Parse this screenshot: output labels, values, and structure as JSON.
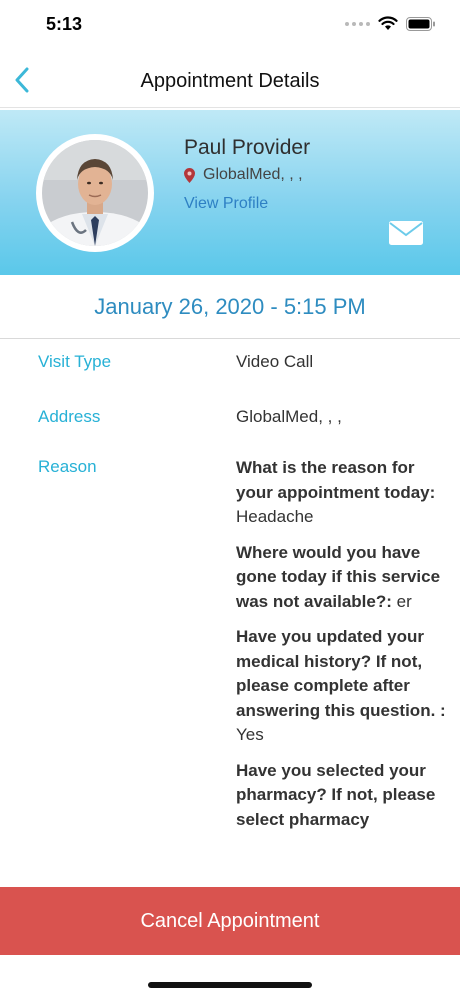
{
  "status_bar": {
    "time": "5:13"
  },
  "nav": {
    "title": "Appointment Details"
  },
  "provider": {
    "name": "Paul Provider",
    "location": "GlobalMed, , ,",
    "view_profile": "View Profile"
  },
  "appointment": {
    "datetime": "January 26, 2020 - 5:15 PM"
  },
  "details": {
    "visit_type_label": "Visit Type",
    "visit_type_value": "Video Call",
    "address_label": "Address",
    "address_value": "GlobalMed, , ,",
    "reason_label": "Reason",
    "qa": [
      {
        "q": "What is the reason for your appointment today:",
        "a": "Headache"
      },
      {
        "q": "Where would you have gone today if this service was not available?:",
        "a": "er"
      },
      {
        "q": "Have you updated your medical history? If not, please complete after answering this question. :",
        "a": "Yes"
      },
      {
        "q": "Have you selected your pharmacy? If not, please select pharmacy",
        "a": ""
      }
    ]
  },
  "actions": {
    "cancel": "Cancel Appointment"
  },
  "colors": {
    "accent": "#27b1d6",
    "date": "#2e8cc0",
    "link": "#2e80c4",
    "danger": "#d9534f",
    "header_gradient_end": "#5ac8ea"
  }
}
